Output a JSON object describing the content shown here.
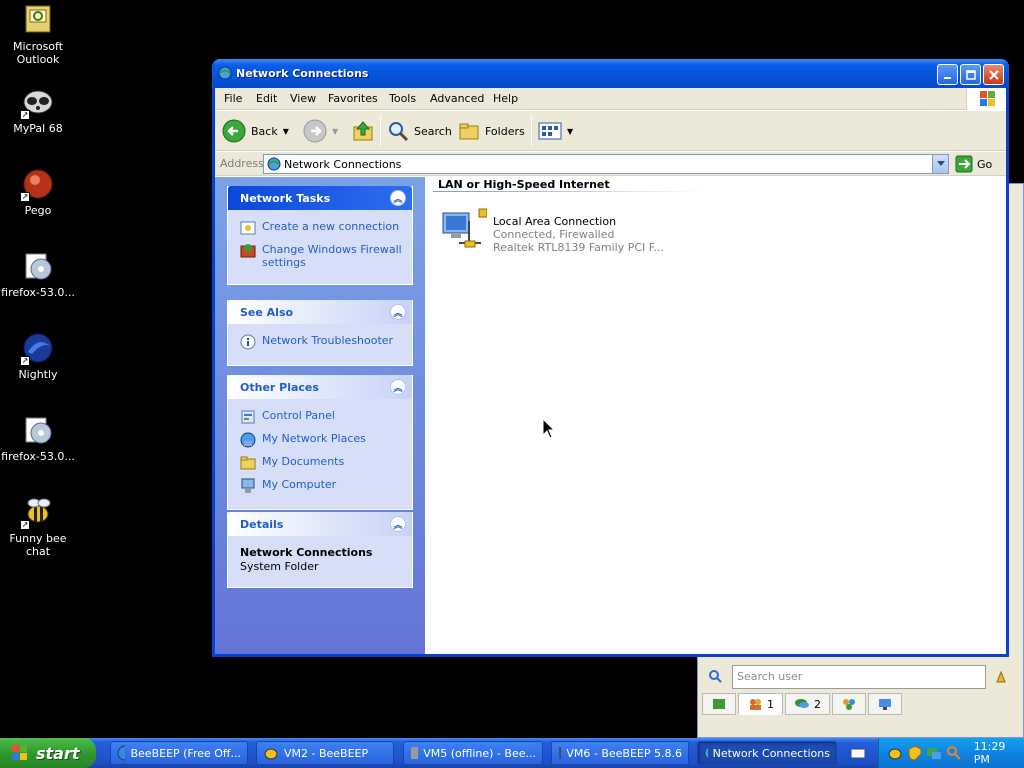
{
  "desktop": {
    "icons": [
      {
        "label": "Microsoft Outlook"
      },
      {
        "label": "MyPal 68"
      },
      {
        "label": "Pego"
      },
      {
        "label": "firefox-53.0..."
      },
      {
        "label": "Nightly"
      },
      {
        "label": "firefox-53.0..."
      },
      {
        "label": "Funny bee chat"
      }
    ]
  },
  "window": {
    "title": "Network Connections",
    "menu": [
      "File",
      "Edit",
      "View",
      "Favorites",
      "Tools",
      "Advanced",
      "Help"
    ],
    "toolbar": {
      "back": "Back",
      "search": "Search",
      "folders": "Folders"
    },
    "address": {
      "label": "Address",
      "value": "Network Connections",
      "go": "Go"
    },
    "panels": {
      "network_tasks": {
        "title": "Network Tasks",
        "items": [
          "Create a new connection",
          "Change Windows Firewall settings"
        ]
      },
      "see_also": {
        "title": "See Also",
        "items": [
          "Network Troubleshooter"
        ]
      },
      "other_places": {
        "title": "Other Places",
        "items": [
          "Control Panel",
          "My Network Places",
          "My Documents",
          "My Computer"
        ]
      },
      "details": {
        "title": "Details",
        "name": "Network Connections",
        "type": "System Folder"
      }
    },
    "content": {
      "group": "LAN or High-Speed Internet",
      "connection": {
        "name": "Local Area Connection",
        "status": "Connected, Firewalled",
        "device": "Realtek RTL8139 Family PCI F..."
      }
    }
  },
  "beebeep": {
    "search_placeholder": "Search user",
    "tab1_count": "1",
    "tab2_count": "2"
  },
  "taskbar": {
    "start": "start",
    "buttons": [
      "BeeBEEP (Free Off...",
      "VM2 - BeeBEEP",
      "VM5 (offline) - Bee...",
      "VM6 - BeeBEEP 5.8.6",
      "Network Connections"
    ],
    "clock": "11:29 PM"
  }
}
